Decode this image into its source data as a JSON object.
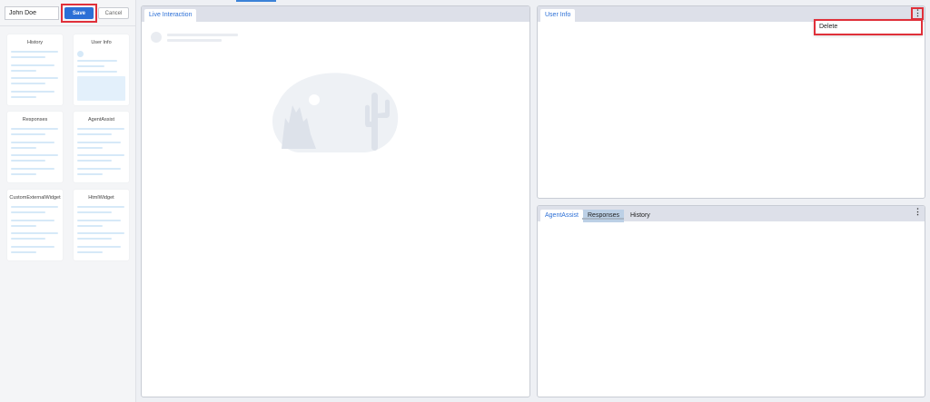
{
  "editor": {
    "name_value": "John Doe",
    "save_label": "Save",
    "cancel_label": "Cancel"
  },
  "widget_palette": [
    {
      "label": "History"
    },
    {
      "label": "User Info"
    },
    {
      "label": "Responses"
    },
    {
      "label": "AgentAssist"
    },
    {
      "label": "CustomExternalWidget"
    },
    {
      "label": "HtmlWidget"
    }
  ],
  "live_panel": {
    "tab_label": "Live Interaction"
  },
  "user_info_panel": {
    "tab_label": "User Info",
    "menu_icon": "vertical-ellipsis-icon",
    "context_menu": {
      "items": [
        {
          "label": "Delete"
        }
      ]
    }
  },
  "bottom_panel": {
    "tabs": [
      {
        "label": "AgentAssist",
        "state": "active"
      },
      {
        "label": "Responses",
        "state": "hover"
      },
      {
        "label": "History",
        "state": "normal"
      }
    ],
    "menu_icon": "vertical-ellipsis-icon"
  },
  "colors": {
    "accent": "#2b6fd6",
    "highlight": "#e0303a",
    "panel_header": "#dde0e9",
    "placeholder": "#d6e9f8"
  }
}
